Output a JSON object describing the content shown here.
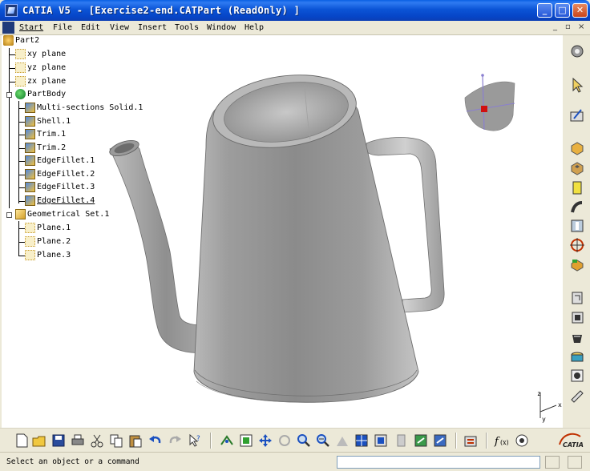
{
  "window": {
    "title": "CATIA V5 - [Exercise2-end.CATPart (ReadOnly) ]",
    "minimize": "_",
    "maximize": "□",
    "close": "✕"
  },
  "menu": {
    "items": [
      "Start",
      "File",
      "Edit",
      "View",
      "Insert",
      "Tools",
      "Window",
      "Help"
    ],
    "doc_controls": [
      "_",
      "▫",
      "×"
    ]
  },
  "tree": {
    "root": "Part2",
    "planes": [
      "xy plane",
      "yz plane",
      "zx plane"
    ],
    "partbody": "PartBody",
    "features": [
      "Multi-sections Solid.1",
      "Shell.1",
      "Trim.1",
      "Trim.2",
      "EdgeFillet.1",
      "EdgeFillet.2",
      "EdgeFillet.3",
      "EdgeFillet.4"
    ],
    "geoset": "Geometrical Set.1",
    "geo_planes": [
      "Plane.1",
      "Plane.2",
      "Plane.3"
    ]
  },
  "axis": {
    "x": "x",
    "y": "y",
    "z": "z"
  },
  "brand": "CATIA",
  "status": {
    "message": "Select an object or a command",
    "command_value": ""
  },
  "colors": {
    "titlebar": "#0b54d6",
    "model": "#9a9a9a",
    "background": "#ffffff"
  },
  "icons": {
    "right_toolbar": [
      "sketcher-icon",
      "select-arrow-icon",
      "sketch-icon",
      "pad-icon",
      "pocket-icon",
      "shaft-icon",
      "rib-icon",
      "hole-icon",
      "point-icon",
      "fillet-icon",
      "chamfer-icon",
      "draft-icon",
      "shell-icon",
      "thickness-icon",
      "boolean-icon",
      "scale-icon",
      "measure-icon",
      "law-icon"
    ],
    "bottom_toolbar": [
      "new-icon",
      "open-icon",
      "save-icon",
      "print-icon",
      "cut-icon",
      "copy-icon",
      "paste-icon",
      "undo-icon",
      "redo-icon",
      "whats-this-icon",
      "fly-icon",
      "fit-all-icon",
      "pan-icon",
      "rotate-icon",
      "zoom-in-icon",
      "zoom-out-icon",
      "normal-view-icon",
      "multi-view-icon",
      "iso-view-icon",
      "view-mode-icon",
      "hide-show-icon",
      "swap-space-icon",
      "update-icon",
      "formula-icon",
      "knowledge-icon"
    ]
  }
}
